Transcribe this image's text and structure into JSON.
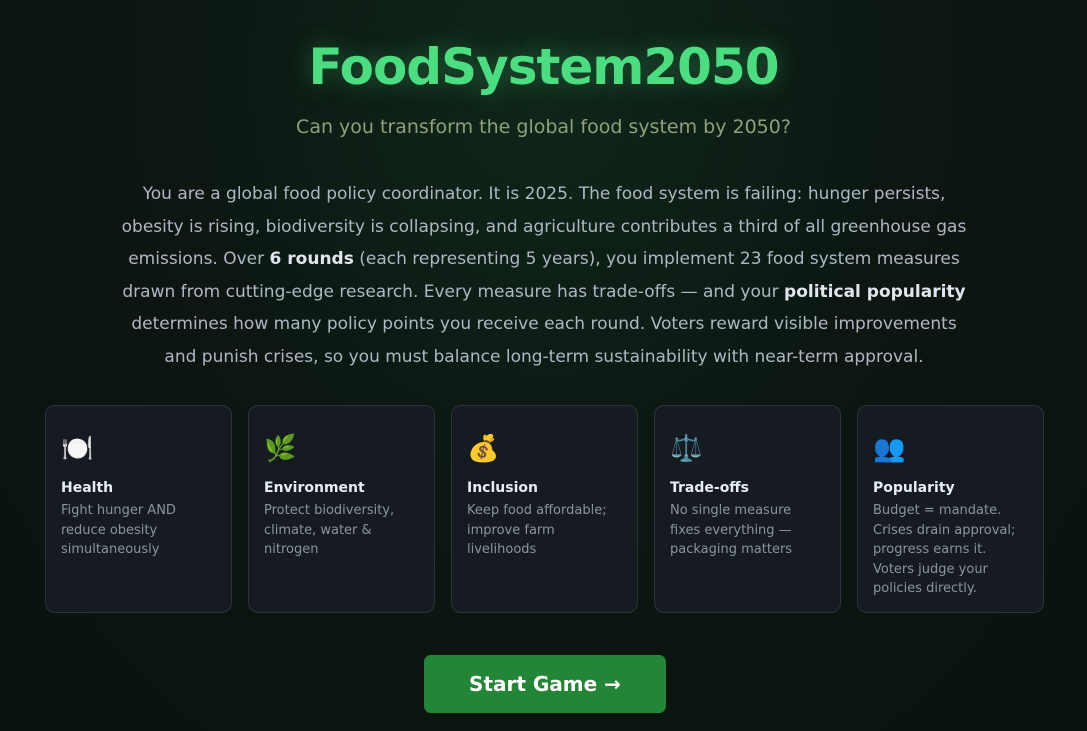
{
  "header": {
    "title": "FoodSystem2050",
    "subtitle": "Can you transform the global food system by 2050?"
  },
  "intro": {
    "part1": "You are a global food policy coordinator. It is 2025. The food system is failing: hunger persists, obesity is rising, biodiversity is collapsing, and agriculture contributes a third of all greenhouse gas emissions. Over ",
    "bold1": "6 rounds",
    "part2": " (each representing 5 years), you implement 23 food system measures drawn from cutting-edge research. Every measure has trade-offs — and your ",
    "bold2": "political popularity",
    "part3": " determines how many policy points you receive each round. Voters reward visible improvements and punish crises, so you must balance long-term sustainability with near-term approval."
  },
  "cards": [
    {
      "icon": "plate-cutlery-icon",
      "glyph": "🍽️",
      "title": "Health",
      "desc": "Fight hunger AND reduce obesity simultaneously"
    },
    {
      "icon": "herb-leaf-icon",
      "glyph": "🌿",
      "title": "Environment",
      "desc": "Protect biodiversity, climate, water & nitrogen"
    },
    {
      "icon": "money-bag-icon",
      "glyph": "💰",
      "title": "Inclusion",
      "desc": "Keep food affordable; improve farm livelihoods"
    },
    {
      "icon": "balance-scale-icon",
      "glyph": "⚖️",
      "title": "Trade-offs",
      "desc": "No single measure fixes everything — packaging matters"
    },
    {
      "icon": "people-icon",
      "glyph": "👥",
      "title": "Popularity",
      "desc": "Budget = mandate. Crises drain approval; progress earns it. Voters judge your policies directly."
    }
  ],
  "actions": {
    "start_label": "Start Game →"
  }
}
